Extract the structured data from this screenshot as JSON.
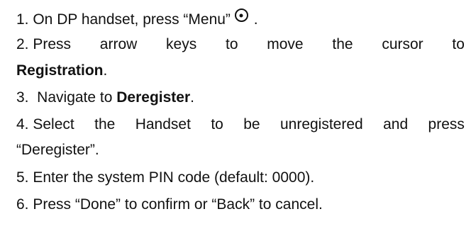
{
  "steps": [
    {
      "prefix": "1. On DP handset, press “Menu”",
      "icon": "menu-circle-dot-icon",
      "suffix": " ."
    },
    {
      "words": [
        "2. Press",
        "arrow",
        "keys",
        "to",
        "move",
        "the",
        "cursor",
        "to"
      ],
      "bold": "Registration",
      "suffix": "."
    },
    {
      "prefix": "3.  Navigate to ",
      "bold": "Deregister",
      "suffix": "."
    },
    {
      "words": [
        "4. Select",
        "the",
        "Handset",
        "to",
        "be",
        "unregistered",
        "and",
        "press"
      ],
      "continuation": "“Deregister”."
    },
    {
      "text": "5. Enter the system PIN code (default: 0000)."
    },
    {
      "text": "6. Press “Done” to confirm or “Back” to cancel."
    }
  ]
}
